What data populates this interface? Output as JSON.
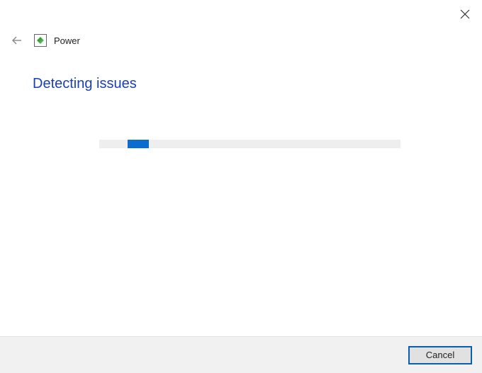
{
  "window": {
    "app_title": "Power"
  },
  "main": {
    "heading": "Detecting issues",
    "progress": {
      "indeterminate": true
    }
  },
  "footer": {
    "cancel_label": "Cancel"
  }
}
